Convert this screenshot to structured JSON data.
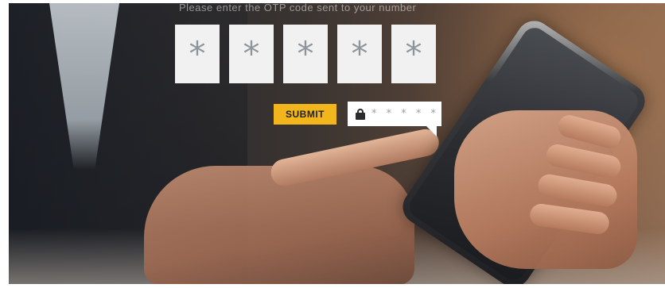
{
  "prompt_text": "Please enter the OTP code sent to your number",
  "otp_boxes": [
    "*",
    "*",
    "*",
    "*",
    "*"
  ],
  "submit_label": "SUBMIT",
  "password_mask": "* * * * *",
  "colors": {
    "submit_bg": "#f2b51c",
    "otp_box_bg": "#f1f1f1",
    "asterisk": "#8f969b"
  },
  "icons": [
    "lock-icon"
  ]
}
